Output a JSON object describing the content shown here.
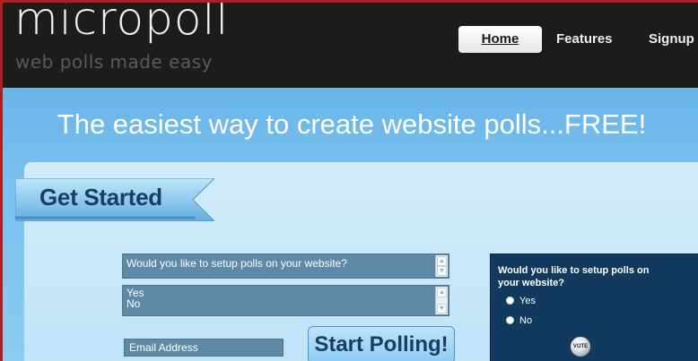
{
  "header": {
    "logo": "micropoll",
    "tagline": "web polls made easy",
    "nav": {
      "home": "Home",
      "features": "Features",
      "signup": "Signup"
    }
  },
  "banner": {
    "headline": "The easiest way to create website polls...FREE!"
  },
  "get_started": {
    "label": "Get Started"
  },
  "form": {
    "question_value": "Would you like to setup polls on your website?",
    "answers": [
      "Yes",
      "No"
    ],
    "email_placeholder": "Email Address",
    "submit_label": "Start Polling!"
  },
  "preview": {
    "question": "Would you like to setup polls on your website?",
    "options": [
      "Yes",
      "No"
    ],
    "vote_label": "VOTE"
  },
  "colors": {
    "header_bg": "#1c1c1c",
    "banner_blue": "#79c1ef",
    "field_bg": "#5f8aa7",
    "preview_bg": "#123a5e",
    "frame_red": "#b01e1e"
  }
}
